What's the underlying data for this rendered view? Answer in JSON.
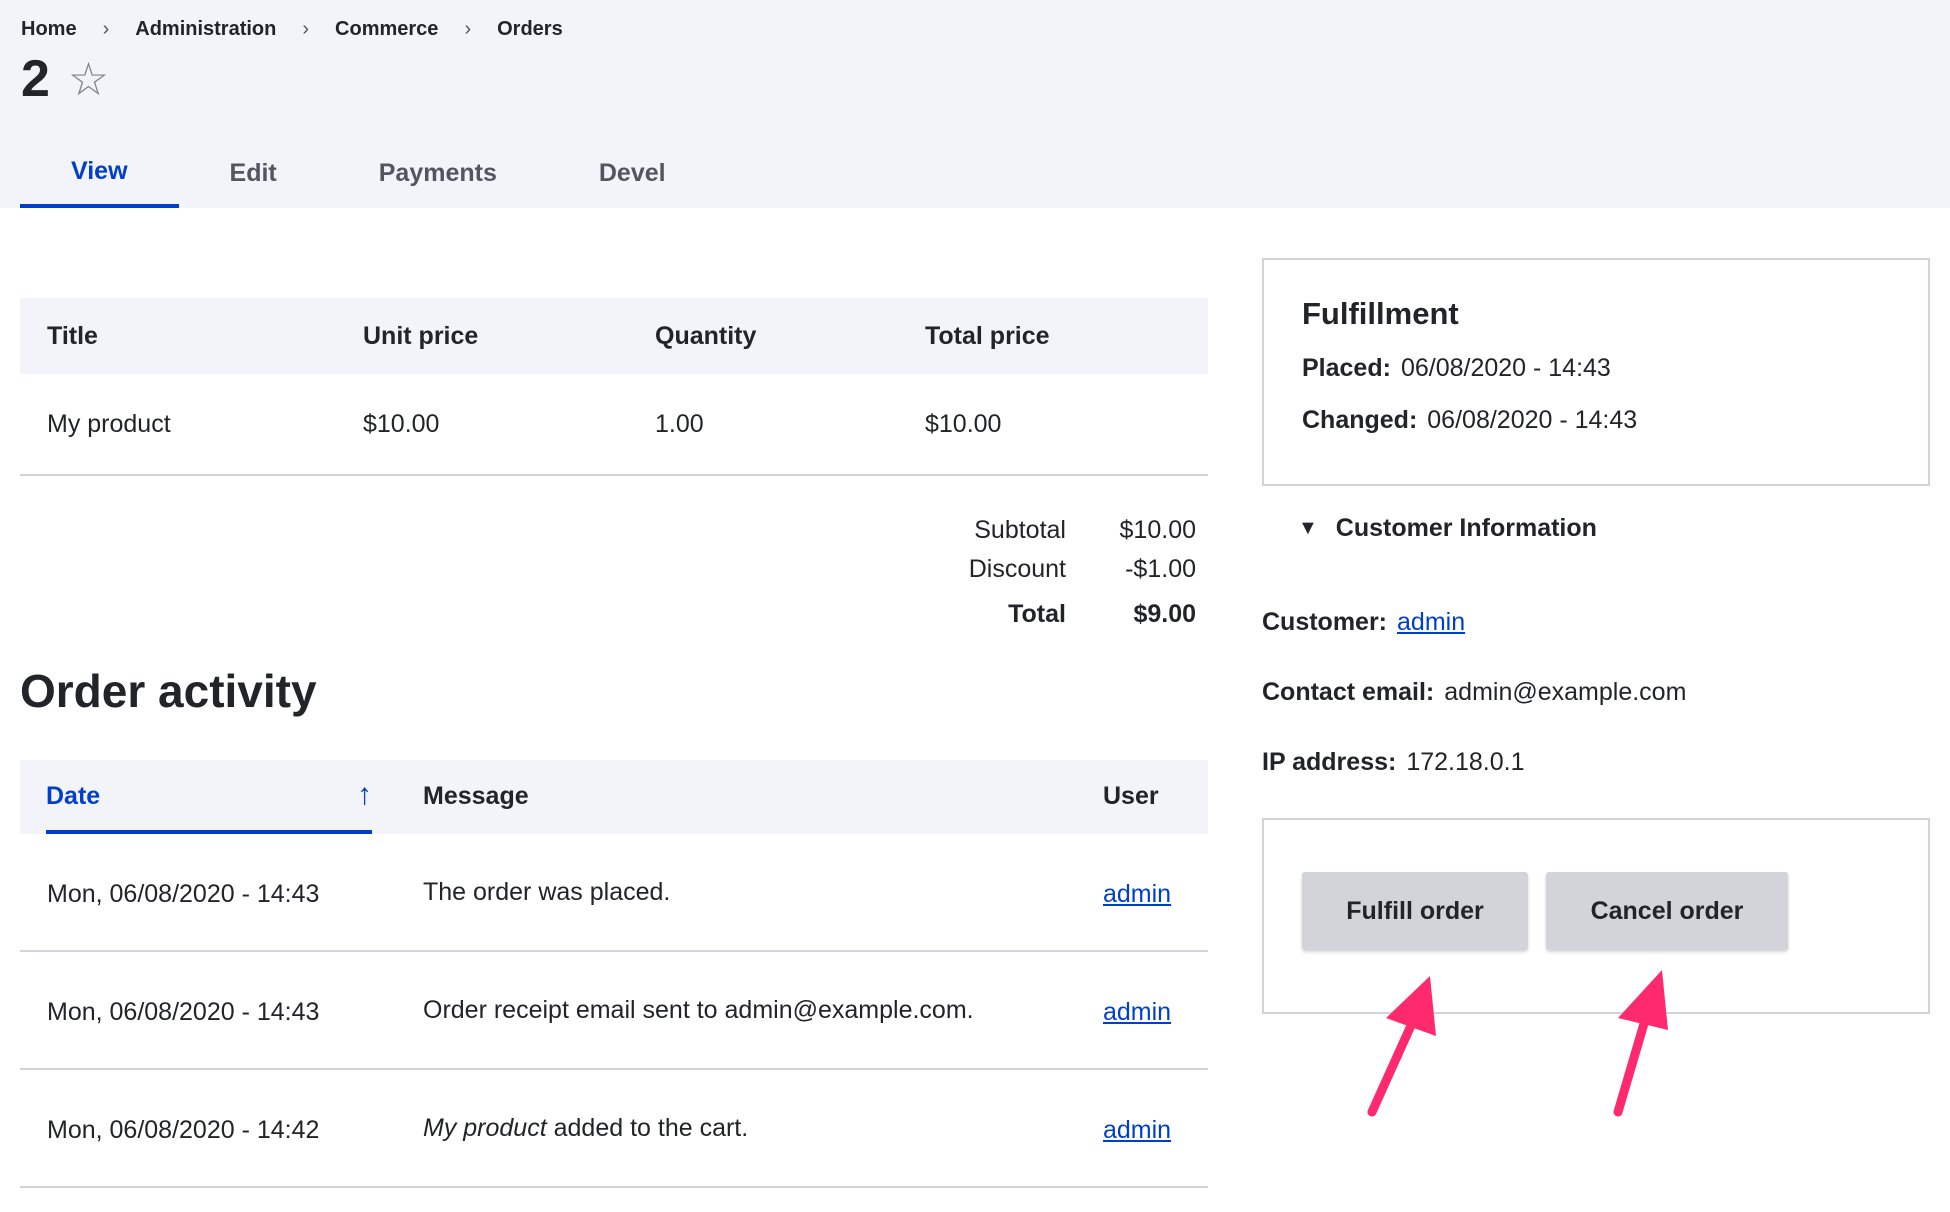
{
  "breadcrumb": {
    "items": [
      "Home",
      "Administration",
      "Commerce",
      "Orders"
    ],
    "separator": "›"
  },
  "page": {
    "title": "2",
    "star_icon": "☆"
  },
  "tabs": [
    {
      "label": "View",
      "active": true
    },
    {
      "label": "Edit",
      "active": false
    },
    {
      "label": "Payments",
      "active": false
    },
    {
      "label": "Devel",
      "active": false
    }
  ],
  "items_table": {
    "headers": [
      "Title",
      "Unit price",
      "Quantity",
      "Total price"
    ],
    "rows": [
      [
        "My product",
        "$10.00",
        "1.00",
        "$10.00"
      ]
    ]
  },
  "totals": {
    "subtotal_label": "Subtotal",
    "subtotal_value": "$10.00",
    "discount_label": "Discount",
    "discount_value": "-$1.00",
    "total_label": "Total",
    "total_value": "$9.00"
  },
  "activity": {
    "title": "Order activity",
    "headers": {
      "date": "Date",
      "message": "Message",
      "user": "User"
    },
    "sort_icon": "↑",
    "rows": [
      {
        "date": "Mon, 06/08/2020 - 14:43",
        "message_em": "",
        "message": "The order was placed.",
        "user": "admin"
      },
      {
        "date": "Mon, 06/08/2020 - 14:43",
        "message_em": "",
        "message": "Order receipt email sent to admin@example.com.",
        "user": "admin"
      },
      {
        "date": "Mon, 06/08/2020 - 14:42",
        "message_em": "My product",
        "message": " added to the cart.",
        "user": "admin"
      }
    ]
  },
  "fulfillment": {
    "title": "Fulfillment",
    "placed_label": "Placed:",
    "placed_value": "06/08/2020 - 14:43",
    "changed_label": "Changed:",
    "changed_value": "06/08/2020 - 14:43"
  },
  "customer": {
    "toggle_label": "Customer Information",
    "toggle_icon": "▼",
    "customer_label": "Customer:",
    "customer_value": "admin",
    "email_label": "Contact email:",
    "email_value": "admin@example.com",
    "ip_label": "IP address:",
    "ip_value": "172.18.0.1"
  },
  "actions": {
    "fulfill_label": "Fulfill order",
    "cancel_label": "Cancel order"
  },
  "colors": {
    "accent": "#003ecc",
    "header_bg": "#f3f4f9",
    "annotation_arrow": "#ff2a6d"
  }
}
